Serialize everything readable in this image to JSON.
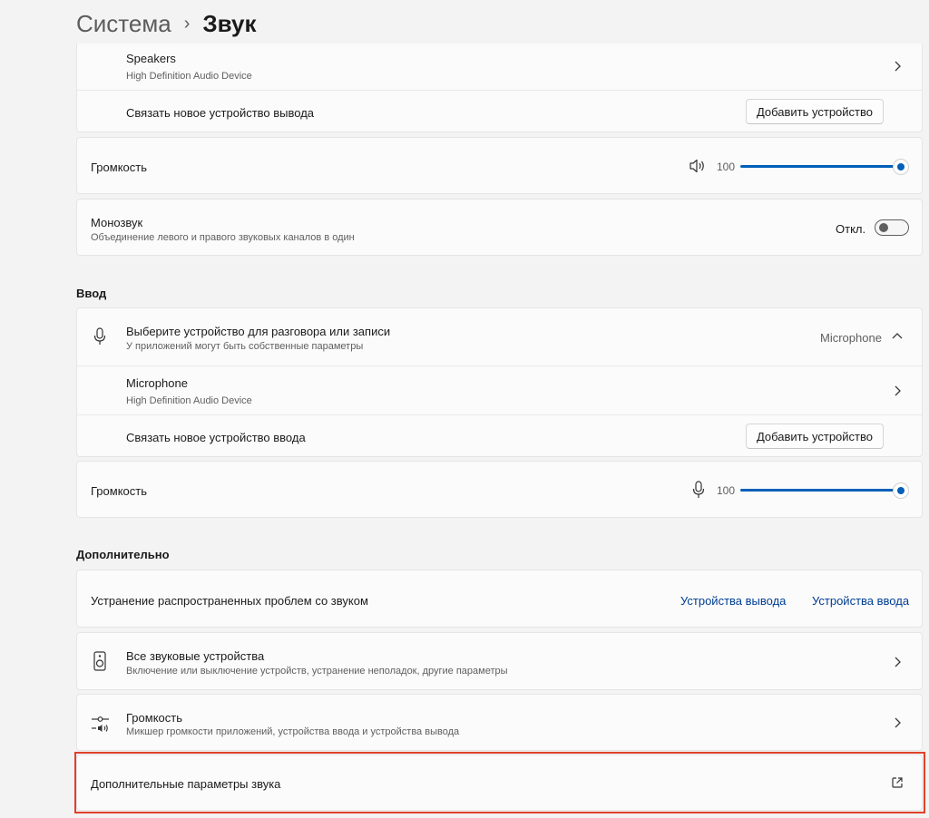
{
  "breadcrumb": {
    "parent": "Система",
    "current": "Звук"
  },
  "output": {
    "device": {
      "name": "Speakers",
      "subtitle": "High Definition Audio Device"
    },
    "pair": {
      "label": "Связать новое устройство вывода",
      "button": "Добавить устройство"
    },
    "volume": {
      "label": "Громкость",
      "value": "100",
      "level": 100
    },
    "mono": {
      "title": "Монозвук",
      "subtitle": "Объединение левого и правого звуковых каналов в один",
      "state": "Откл.",
      "on": false
    }
  },
  "input": {
    "title": "Ввод",
    "select": {
      "title": "Выберите устройство для разговора или записи",
      "subtitle": "У приложений могут быть собственные параметры",
      "value": "Microphone"
    },
    "device": {
      "name": "Microphone",
      "subtitle": "High Definition Audio Device"
    },
    "pair": {
      "label": "Связать новое устройство ввода",
      "button": "Добавить устройство"
    },
    "volume": {
      "label": "Громкость",
      "value": "100",
      "level": 100
    }
  },
  "advanced": {
    "title": "Дополнительно",
    "troubleshoot": {
      "label": "Устранение распространенных проблем со звуком",
      "output_link": "Устройства вывода",
      "input_link": "Устройства ввода"
    },
    "all_devices": {
      "title": "Все звуковые устройства",
      "subtitle": "Включение или выключение устройств, устранение неполадок, другие параметры"
    },
    "mixer": {
      "title": "Громкость",
      "subtitle": "Микшер громкости приложений, устройства ввода и устройства вывода"
    },
    "more": {
      "label": "Дополнительные параметры звука"
    }
  },
  "colors": {
    "accent": "#005fb8",
    "highlight": "#e0412b",
    "link": "#003e92"
  }
}
